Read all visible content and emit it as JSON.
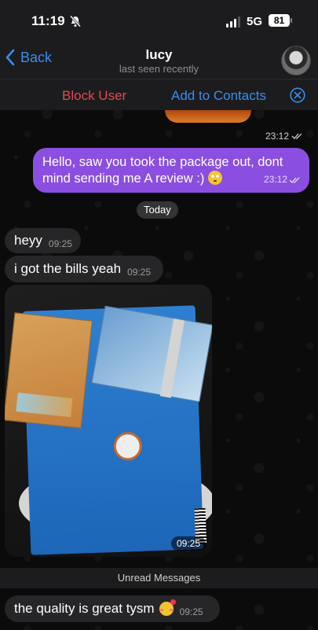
{
  "status_bar": {
    "time": "11:19",
    "network": "5G",
    "battery": "81",
    "icons": [
      "bell-slash-icon",
      "signal-icon",
      "battery-icon"
    ]
  },
  "header": {
    "back_label": "Back",
    "contact_name": "lucy",
    "contact_status": "last seen recently"
  },
  "action_bar": {
    "block_label": "Block User",
    "add_contact_label": "Add to Contacts",
    "block_color": "#e5494b",
    "accent_color": "#3b8ded"
  },
  "messages": {
    "prev_time": "23:12",
    "outgoing": {
      "text": "Hello, saw you took the package out, dont mind sending me A review :)",
      "emoji": "flushed-face",
      "time": "23:12",
      "bubble_color": "#8a4fe0"
    },
    "date_divider": "Today",
    "incoming": [
      {
        "text": "heyy",
        "time": "09:25"
      },
      {
        "text": "i got the bills yeah",
        "time": "09:25"
      }
    ],
    "photo_time": "09:25",
    "unread_label": "Unread Messages",
    "last": {
      "text": "the quality is great tysm",
      "emoji": "smiling-face-with-hearts",
      "time": "09:25"
    }
  }
}
